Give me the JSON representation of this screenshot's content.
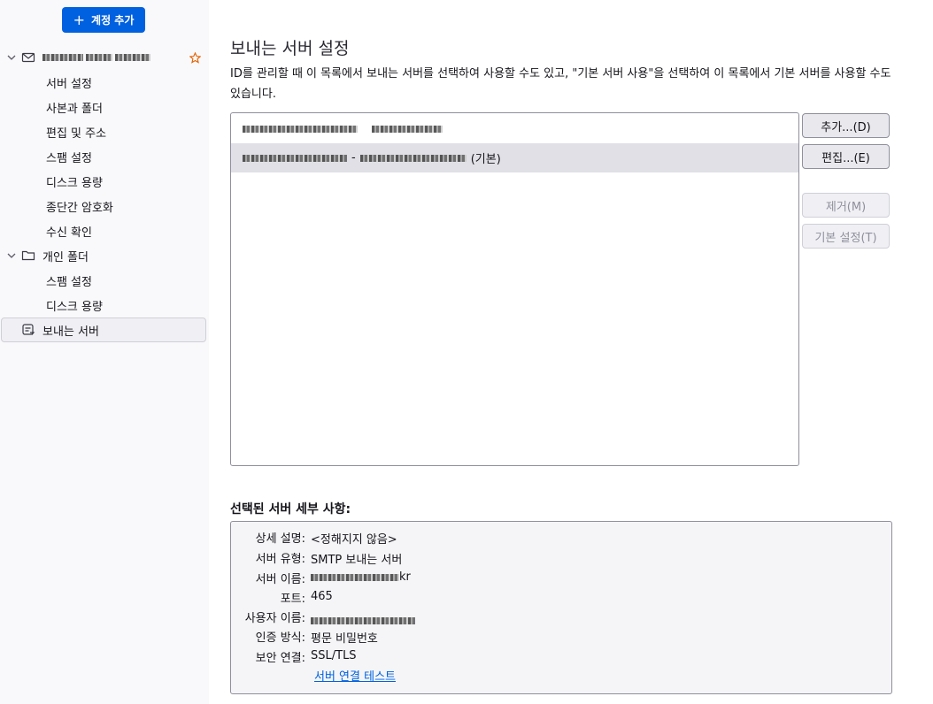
{
  "sidebar": {
    "add_account_label": "계정 추가",
    "account_name": "████@████.com",
    "account_subitems": [
      "서버 설정",
      "사본과 폴더",
      "편집 및 주소",
      "스팸 설정",
      "디스크 용량",
      "종단간 암호화",
      "수신 확인"
    ],
    "local_folders_label": "개인 폴더",
    "local_subitems": [
      "스팸 설정",
      "디스크 용량"
    ],
    "outgoing_label": "보내는 서버"
  },
  "main": {
    "title": "보내는 서버 설정",
    "description": "ID를 관리할 때 이 목록에서 보내는 서버를 선택하여 사용할 수도 있고, \"기본 서버 사용\"을 선택하여 이 목록에서 기본 서버를 사용할 수도 있습니다.",
    "server_rows": [
      {
        "suffix": ""
      },
      {
        "suffix": "(기본)"
      }
    ],
    "buttons": {
      "add": "추가...(D)",
      "edit": "편집...(E)",
      "remove": "제거(M)",
      "set_default": "기본 설정(T)"
    },
    "details_heading": "선택된 서버 세부 사항:",
    "details": {
      "desc_label": "상세 설명:",
      "desc_value": "<정해지지 않음>",
      "type_label": "서버 유형:",
      "type_value": "SMTP 보내는 서버",
      "name_label": "서버 이름:",
      "name_value_suffix": "kr",
      "port_label": "포트:",
      "port_value": "465",
      "user_label": "사용자 이름:",
      "auth_label": "인증 방식:",
      "auth_value": "평문 비밀번호",
      "sec_label": "보안 연결:",
      "sec_value": "SSL/TLS",
      "test_link": "서버 연결 테스트"
    }
  },
  "colors": {
    "accent": "#0061e0",
    "selection": "#e0e0e6",
    "star": "#e66000"
  }
}
